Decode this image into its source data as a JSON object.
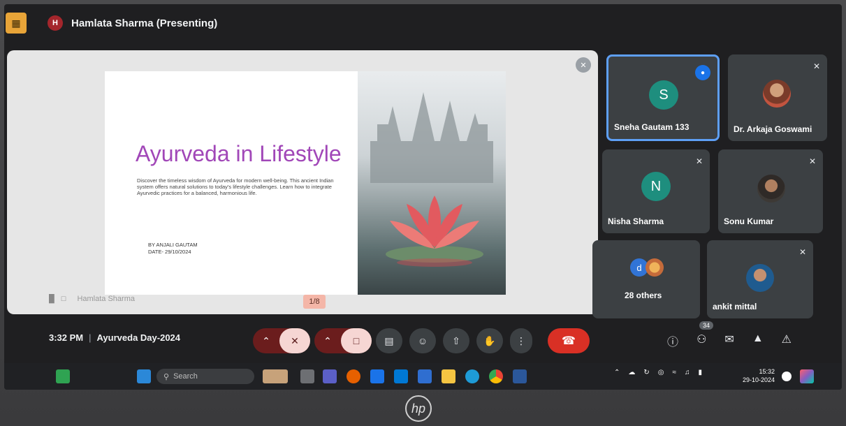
{
  "topbar": {
    "presenter_initial": "H",
    "presenter_label": "Hamlata Sharma (Presenting)"
  },
  "slide": {
    "title": "Ayurveda in Lifestyle",
    "description": "Discover the timeless wisdom of Ayurveda for modern well-being. This ancient Indian system offers natural solutions to today's lifestyle challenges. Learn how to integrate Ayurvedic practices for a balanced, harmonious life.",
    "author": "BY ANJALI GAUTAM",
    "date": "DATE- 29/10/2024",
    "page": "1/8",
    "presenter_footer": "Hamlata Sharma"
  },
  "participants": [
    {
      "name": "Sneha Gautam 133",
      "initial": "S",
      "avatar_color": "#1e8e7e",
      "speaking": true
    },
    {
      "name": "Dr. Arkaja Goswami",
      "muted": true
    },
    {
      "name": "Nisha Sharma",
      "initial": "N",
      "avatar_color": "#1e8e7e",
      "muted": true
    },
    {
      "name": "Sonu Kumar",
      "muted": true
    },
    {
      "name": "28 others",
      "initial": "d"
    },
    {
      "name": "ankit mittal",
      "muted": true
    }
  ],
  "controls": {
    "time": "3:32 PM",
    "meeting": "Ayurveda Day-2024",
    "people_count": "34"
  },
  "taskbar": {
    "search_placeholder": "Search",
    "time": "15:32",
    "date": "29-10-2024"
  },
  "brand": "hp",
  "colors": {
    "accent": "#1a73e8",
    "hangup": "#d93025",
    "title": "#a147b8",
    "tile": "#3c4043"
  }
}
